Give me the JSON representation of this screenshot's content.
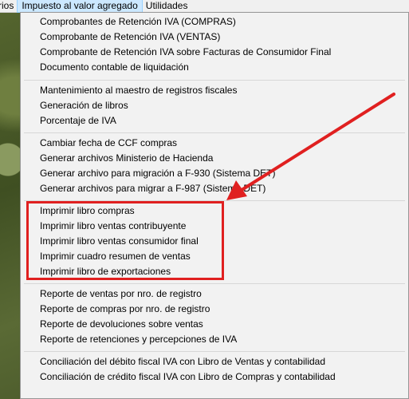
{
  "menubar": {
    "items": [
      "rios",
      "Impuesto al valor agregado",
      "Utilidades"
    ]
  },
  "menu": {
    "group1": [
      "Comprobantes de Retención IVA (COMPRAS)",
      "Comprobante de Retención IVA (VENTAS)",
      "Comprobante de Retención IVA sobre Facturas de Consumidor Final",
      "Documento contable de liquidación"
    ],
    "group2": [
      "Mantenimiento al maestro de registros fiscales",
      "Generación de libros",
      "Porcentaje de IVA"
    ],
    "group3": [
      "Cambiar fecha de CCF compras",
      "Generar archivos Ministerio de Hacienda",
      "Generar archivo para migración a F-930 (Sistema DET)",
      "Generar archivos  para migrar a F-987 (Sistema DET)"
    ],
    "group4": [
      "Imprimir libro compras",
      "Imprimir libro ventas contribuyente",
      "Imprimir libro ventas consumidor final",
      "Imprimir cuadro resumen de ventas",
      "Imprimir libro de exportaciones"
    ],
    "group5": [
      "Reporte de ventas por nro. de registro",
      "Reporte de compras por nro. de registro",
      "Reporte de devoluciones sobre ventas",
      "Reporte de retenciones y percepciones de IVA"
    ],
    "group6": [
      "Conciliación del débito fiscal IVA con Libro de Ventas y contabilidad",
      "Conciliación de crédito fiscal IVA con Libro de Compras y contabilidad"
    ]
  },
  "annotation": {
    "color": "#e02020"
  }
}
